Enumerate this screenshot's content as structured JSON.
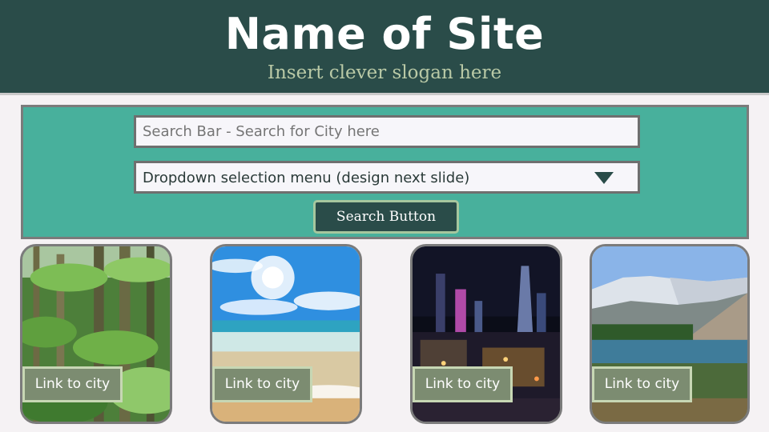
{
  "header": {
    "title": "Name of Site",
    "slogan": "Insert clever slogan here"
  },
  "search": {
    "placeholder": "Search Bar - Search for City here",
    "dropdown_label": "Dropdown selection menu (design next slide)",
    "button_label": "Search Button"
  },
  "cards": [
    {
      "image": "jungle-image",
      "link_label": "Link to city"
    },
    {
      "image": "beach-image",
      "link_label": "Link to city"
    },
    {
      "image": "city-night-image",
      "link_label": "Link to city"
    },
    {
      "image": "mountain-lake-image",
      "link_label": "Link to city"
    }
  ],
  "colors": {
    "header_bg": "#2a4c49",
    "panel_bg": "#48b09c",
    "link_bg": "#7c8c71",
    "slogan": "#b9c9a6"
  }
}
